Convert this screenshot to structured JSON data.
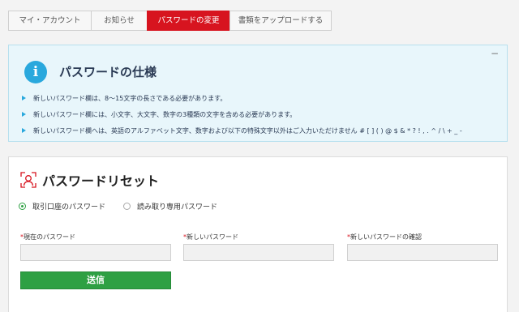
{
  "tabs": [
    {
      "label": "マイ・アカウント",
      "active": false
    },
    {
      "label": "お知らせ",
      "active": false
    },
    {
      "label": "パスワードの変更",
      "active": true
    },
    {
      "label": "書類をアップロードする",
      "active": false
    }
  ],
  "info": {
    "title": "パスワードの仕様",
    "collapse_symbol": "−",
    "rules": [
      "新しいパスワード欄は、8～15文字の長さである必要があります。",
      "新しいパスワード欄には、小文字、大文字、数字の3種類の文字を含める必要があります。",
      "新しいパスワード欄へは、英語のアルファベット文字、数字および以下の特殊文字以外はご入力いただけません # [ ] ( ) @ $ & * ? ! , . ^ / \\ + _ -"
    ]
  },
  "reset": {
    "title": "パスワードリセット",
    "radio_options": [
      {
        "label": "取引口座のパスワード",
        "checked": true
      },
      {
        "label": "読み取り専用パスワード",
        "checked": false
      }
    ],
    "required_mark": "*",
    "fields": [
      {
        "label": "現在のパスワード",
        "value": ""
      },
      {
        "label": "新しいパスワード",
        "value": ""
      },
      {
        "label": "新しいパスワードの確認",
        "value": ""
      }
    ],
    "submit_label": "送信"
  },
  "colors": {
    "accent_red": "#d7141f",
    "info_blue": "#29a8dd",
    "submit_green": "#2ea043"
  }
}
